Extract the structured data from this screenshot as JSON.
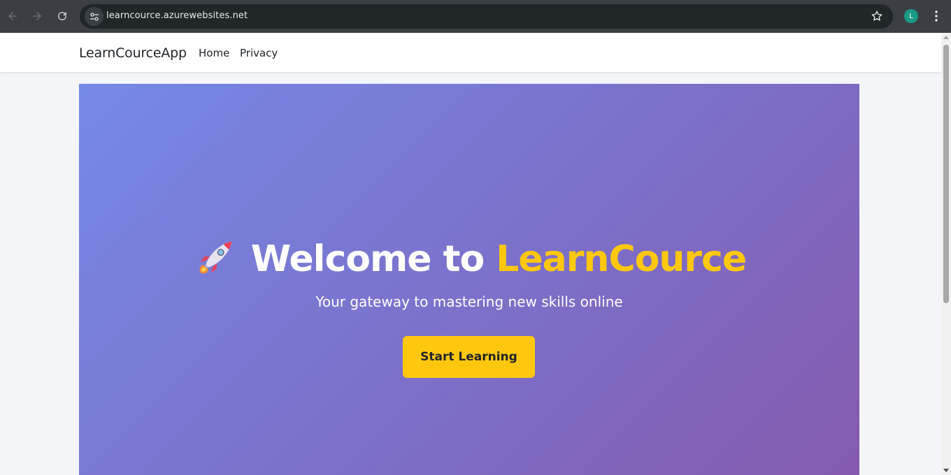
{
  "browser": {
    "url": "learncource.azurewebsites.net",
    "profile_initial": "L",
    "icons": {
      "back": "back-arrow-icon",
      "forward": "forward-arrow-icon",
      "reload": "reload-icon",
      "site_info": "tune-icon",
      "bookmark": "star-icon",
      "menu": "kebab-menu-icon"
    }
  },
  "navbar": {
    "brand": "LearnCourceApp",
    "links": [
      "Home",
      "Privacy"
    ]
  },
  "hero": {
    "title_prefix": "Welcome to ",
    "title_accent": "LearnCource",
    "subtitle": "Your gateway to mastering new skills online",
    "cta_label": "Start Learning",
    "icon": "rocket-icon"
  },
  "colors": {
    "accent": "#ffc80f",
    "hero_gradient_start": "#7589e6",
    "hero_gradient_end": "#855aae",
    "chrome": "#3b3f43",
    "profile_avatar": "#1a9a86"
  }
}
